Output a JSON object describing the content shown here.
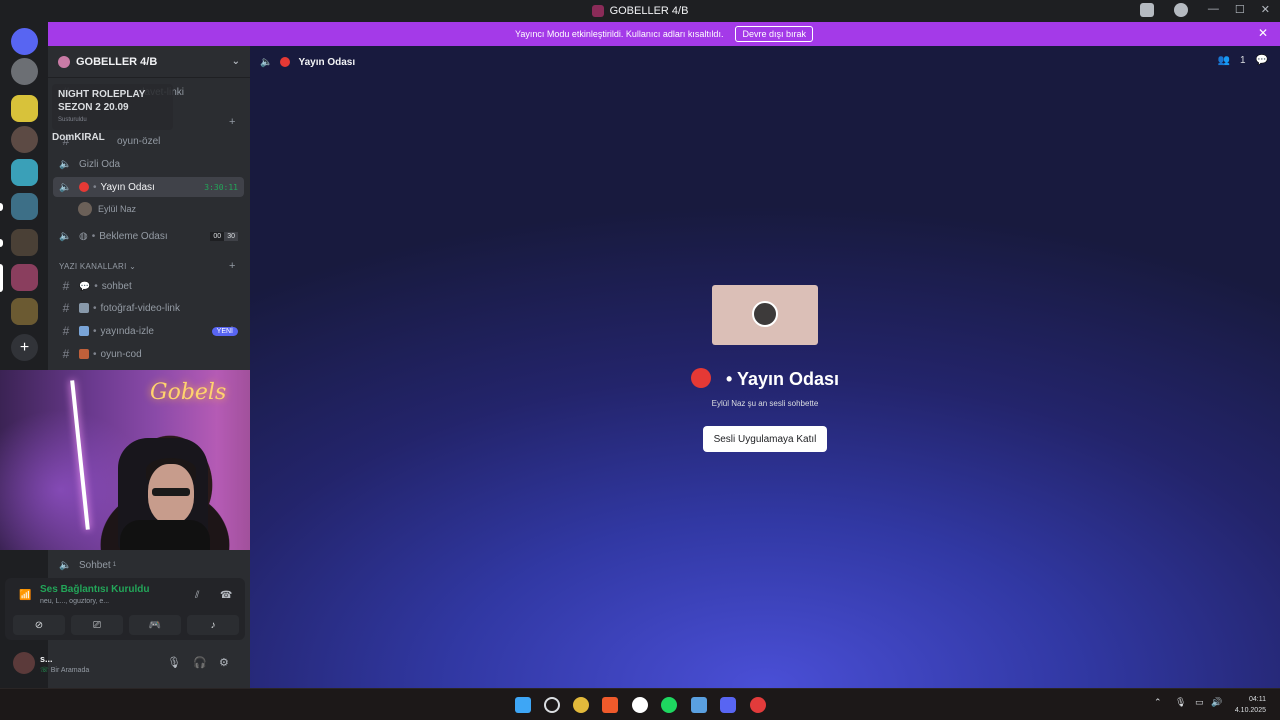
{
  "window": {
    "title": "GOBELLER 4/B"
  },
  "banner": {
    "text": "Yayıncı Modu etkinleştirildi. Kullanıcı adları kısaltıldı.",
    "button": "Devre dışı bırak",
    "close": "✕"
  },
  "guild": {
    "name": "GOBELLER 4/B"
  },
  "tooltip": {
    "title": "NIGHT ROLEPLAY SEZON 2 20.09",
    "sub": "Susturuldu",
    "second": "DomKIRAL"
  },
  "channels": {
    "invite": "davet-linki",
    "ozel": "oyun-özel",
    "gizli": "Gizli Oda",
    "yayin": "Yayın Odası",
    "yayin_timer": "3:30:11",
    "yayin_user": "Eylül Naz",
    "bekleme": "Bekleme Odası",
    "bekleme_counts": [
      "00",
      "30"
    ],
    "text_category": "YAZI KANALLARI",
    "sohbet": "sohbet",
    "foto": "fotoğraf-video-link",
    "yayinda": "yayında-izle",
    "new_badge": "YENİ",
    "oyun_cod": "oyun-cod",
    "sohbet_voice": "Sohbet",
    "sohbet_voice_count": "1"
  },
  "webcam": {
    "neon_text": "Gobels"
  },
  "voice_panel": {
    "status": "Ses Bağlantısı Kuruldu",
    "sub": "neu, L..., oguztory, e..."
  },
  "user_panel": {
    "name": "s...",
    "status": "Bir Aramada"
  },
  "main": {
    "header_title": "Yayın Odası",
    "member_count": "1",
    "stage_title": "Yayın Odası",
    "stage_sub": "Eylül Naz şu an sesli sohbette",
    "join_button": "Sesli Uygulamaya Katıl"
  },
  "taskbar": {
    "time": "04:11",
    "date": "4.10.2025"
  },
  "colors": {
    "banner": "#a43ae8",
    "accent": "#5865f2",
    "green": "#23a559",
    "live_red": "#e53935"
  }
}
